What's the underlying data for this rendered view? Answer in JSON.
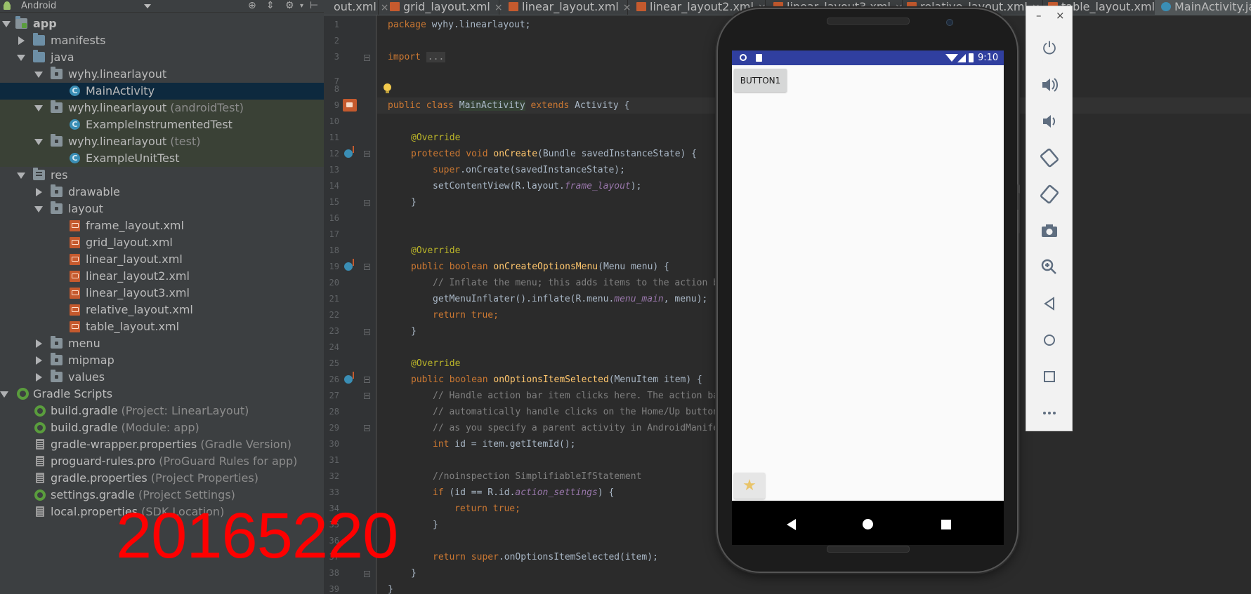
{
  "project": {
    "header_title": "Android",
    "rows": [
      {
        "label": "app",
        "hint": ""
      },
      {
        "label": "manifests",
        "hint": ""
      },
      {
        "label": "java",
        "hint": ""
      },
      {
        "label": "wyhy.linearlayout",
        "hint": ""
      },
      {
        "label": "MainActivity",
        "hint": ""
      },
      {
        "label": "wyhy.linearlayout",
        "hint": " (androidTest)"
      },
      {
        "label": "ExampleInstrumentedTest",
        "hint": ""
      },
      {
        "label": "wyhy.linearlayout",
        "hint": " (test)"
      },
      {
        "label": "ExampleUnitTest",
        "hint": ""
      },
      {
        "label": "res",
        "hint": ""
      },
      {
        "label": "drawable",
        "hint": ""
      },
      {
        "label": "layout",
        "hint": ""
      },
      {
        "label": "frame_layout.xml",
        "hint": ""
      },
      {
        "label": "grid_layout.xml",
        "hint": ""
      },
      {
        "label": "linear_layout.xml",
        "hint": ""
      },
      {
        "label": "linear_layout2.xml",
        "hint": ""
      },
      {
        "label": "linear_layout3.xml",
        "hint": ""
      },
      {
        "label": "relative_layout.xml",
        "hint": ""
      },
      {
        "label": "table_layout.xml",
        "hint": ""
      },
      {
        "label": "menu",
        "hint": ""
      },
      {
        "label": "mipmap",
        "hint": ""
      },
      {
        "label": "values",
        "hint": ""
      },
      {
        "label": "Gradle Scripts",
        "hint": ""
      },
      {
        "label": "build.gradle",
        "hint": " (Project: LinearLayout)"
      },
      {
        "label": "build.gradle",
        "hint": " (Module: app)"
      },
      {
        "label": "gradle-wrapper.properties",
        "hint": " (Gradle Version)"
      },
      {
        "label": "proguard-rules.pro",
        "hint": " (ProGuard Rules for app)"
      },
      {
        "label": "gradle.properties",
        "hint": " (Project Properties)"
      },
      {
        "label": "settings.gradle",
        "hint": " (Project Settings)"
      },
      {
        "label": "local.properties",
        "hint": " (SDK Location)"
      }
    ]
  },
  "tabs": [
    {
      "label": "out.xml"
    },
    {
      "label": "grid_layout.xml"
    },
    {
      "label": "linear_layout.xml"
    },
    {
      "label": "linear_layout2.xml"
    },
    {
      "label": "linear_layout3.xml"
    },
    {
      "label": "relative_layout.xml"
    },
    {
      "label": "table_layout.xml"
    },
    {
      "label": "MainActivity.ja"
    }
  ],
  "code": {
    "line_numbers": [
      "1",
      "2",
      "3",
      "7",
      "8",
      "9",
      "10",
      "11",
      "12",
      "13",
      "14",
      "15",
      "16",
      "17",
      "18",
      "19",
      "20",
      "21",
      "22",
      "23",
      "24",
      "25",
      "26",
      "27",
      "28",
      "29",
      "30",
      "31",
      "32",
      "33",
      "34",
      "35",
      "36",
      "37",
      "38",
      "39"
    ],
    "l1_kw": "package",
    "l1_rest": " wyhy.linearlayout;",
    "l3_kw": "import",
    "l3_fold": "...",
    "l9_kw": "public class",
    "l9_cls": "MainActivity",
    "l9_kw2": "extends",
    "l9_rest": " Activity {",
    "l11": "@Override",
    "l12_kw": "protected void",
    "l12_fn": "onCreate",
    "l12_rest": "(Bundle savedInstanceState) {",
    "l13_kw": "super",
    "l13_rest": ".onCreate(savedInstanceState);",
    "l14_a": "setContentView(R.layout.",
    "l14_it": "frame_layout",
    "l14_b": ");",
    "l15": "}",
    "l18": "@Override",
    "l19_kw": "public boolean",
    "l19_fn": "onCreateOptionsMenu",
    "l19_rest": "(Menu menu) {",
    "l20": "// Inflate the menu; this adds items to the action bar",
    "l21_a": "getMenuInflater().inflate(R.menu.",
    "l21_it": "menu_main",
    "l21_b": ", menu);",
    "l22_kw": "return true",
    "l22_rest": ";",
    "l23": "}",
    "l25": "@Override",
    "l26_kw": "public boolean",
    "l26_fn": "onOptionsItemSelected",
    "l26_rest": "(MenuItem item) {",
    "l27": "// Handle action bar item clicks here. The action bar",
    "l28": "// automatically handle clicks on the Home/Up button,",
    "l29": "// as you specify a parent activity in AndroidManifest",
    "l30_kw": "int",
    "l30_rest": " id = item.getItemId();",
    "l32": "//noinspection SimplifiableIfStatement",
    "l33_kw": "if",
    "l33_a": " (id == R.id.",
    "l33_it": "action_settings",
    "l33_b": ") {",
    "l34_kw": "return true",
    "l34_rest": ";",
    "l35": "}",
    "l37_kw": "return super",
    "l37_rest": ".onOptionsItemSelected(item);",
    "l38": "}",
    "l39": "}"
  },
  "emulator": {
    "status_time": "9:10",
    "button1_label": "BUTTON1",
    "fab_icon": "star-icon",
    "toolbar": {
      "minimize_label": "–",
      "close_label": "×",
      "icons": [
        "power-icon",
        "volume-up-icon",
        "volume-down-icon",
        "rotate-left-icon",
        "rotate-right-icon",
        "camera-icon",
        "zoom-icon",
        "back-icon",
        "home-icon",
        "overview-icon",
        "more-icon"
      ]
    }
  },
  "watermark": "20165220"
}
